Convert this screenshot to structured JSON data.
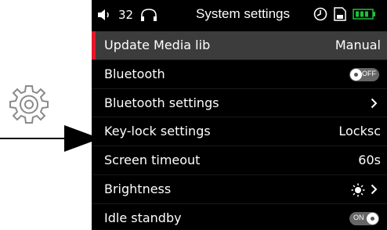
{
  "status_bar": {
    "volume_level": "32",
    "title": "System settings",
    "battery_color": "#1fbf3a"
  },
  "settings": {
    "update_media": {
      "label": "Update Media lib",
      "value": "Manual"
    },
    "bluetooth": {
      "label": "Bluetooth",
      "toggle_text": "OFF",
      "state": "off"
    },
    "bluetooth_settings": {
      "label": "Bluetooth settings"
    },
    "key_lock": {
      "label": "Key-lock settings",
      "value": "Locksc"
    },
    "screen_timeout": {
      "label": "Screen timeout",
      "value": "60s"
    },
    "brightness": {
      "label": "Brightness"
    },
    "idle_standby": {
      "label": "Idle standby",
      "toggle_text": "ON",
      "state": "on"
    }
  },
  "icons": {
    "left_panel": "gear-icon",
    "pointer": "arrow-icon",
    "status": [
      "speaker-icon",
      "headphones-icon",
      "clock-icon",
      "sd-card-icon",
      "battery-icon"
    ]
  },
  "colors": {
    "screen_bg": "#000000",
    "selected_row_bg": "#3c3c3c",
    "selection_accent": "#e4162b",
    "toggle_bg": "#666666"
  }
}
